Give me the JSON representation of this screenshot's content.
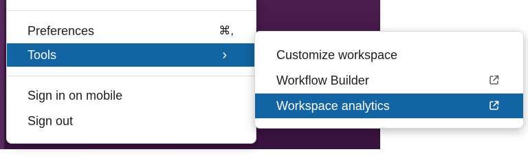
{
  "main_menu": {
    "items": [
      {
        "label": "Preferences",
        "shortcut": "⌘,"
      },
      {
        "label": "Tools",
        "chevron": "›"
      },
      {
        "label": "Sign in on mobile"
      },
      {
        "label": "Sign out"
      }
    ]
  },
  "tools_submenu": {
    "items": [
      {
        "label": "Customize workspace"
      },
      {
        "label": "Workflow Builder",
        "icon": "external-link-icon"
      },
      {
        "label": "Workspace analytics",
        "icon": "external-link-icon"
      }
    ]
  },
  "colors": {
    "highlight": "#1264a3",
    "background": "#3f1642"
  }
}
